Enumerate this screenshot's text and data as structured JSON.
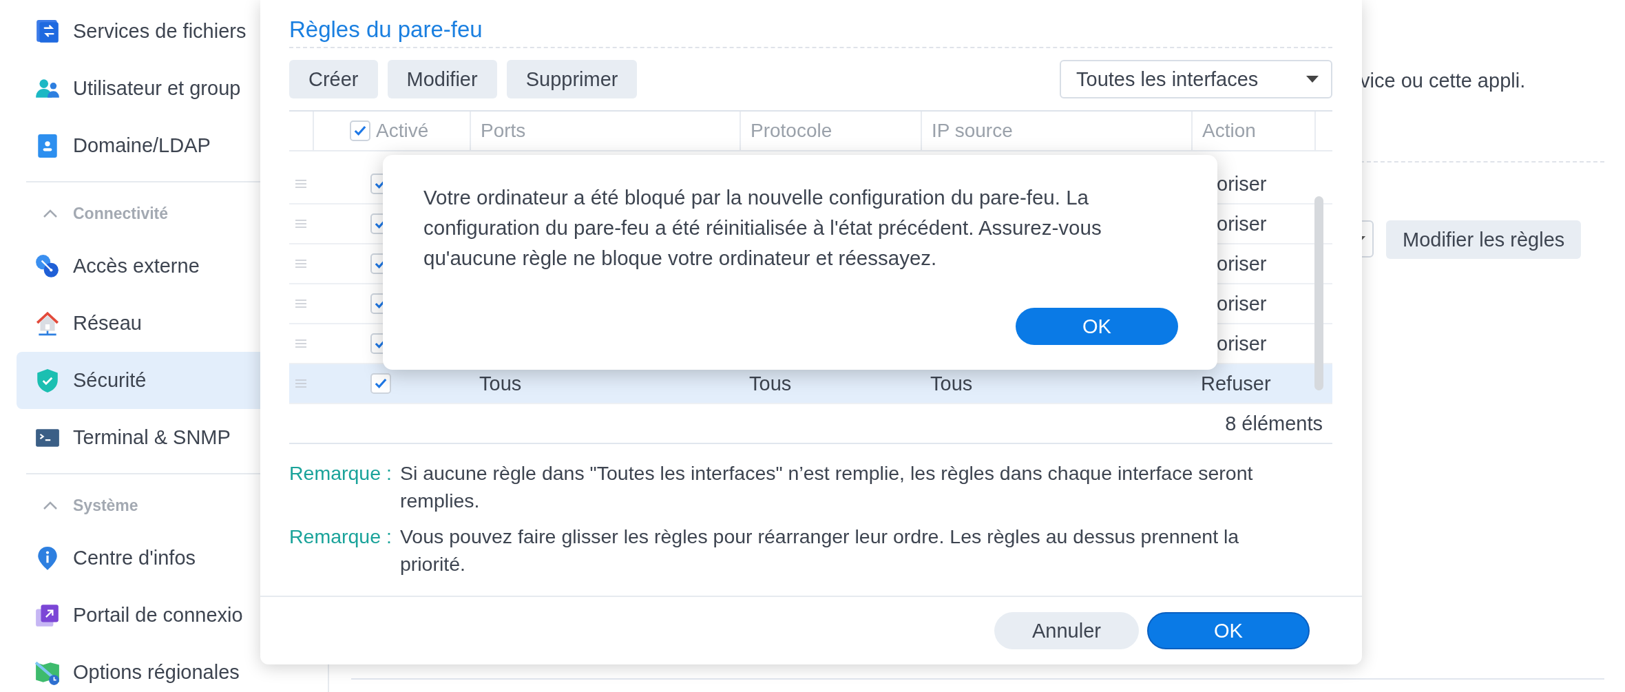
{
  "sidebar": {
    "items": [
      {
        "kind": "item",
        "label": "Services de fichiers",
        "selected": false
      },
      {
        "kind": "item",
        "label": "Utilisateur et group",
        "selected": false
      },
      {
        "kind": "item",
        "label": "Domaine/LDAP",
        "selected": false
      },
      {
        "kind": "header",
        "label": "Connectivité",
        "expanded": true
      },
      {
        "kind": "item",
        "label": "Accès externe",
        "selected": false
      },
      {
        "kind": "item",
        "label": "Réseau",
        "selected": false
      },
      {
        "kind": "item",
        "label": "Sécurité",
        "selected": true
      },
      {
        "kind": "item",
        "label": "Terminal & SNMP",
        "selected": false
      },
      {
        "kind": "header",
        "label": "Système",
        "expanded": true
      },
      {
        "kind": "item",
        "label": "Centre d'infos",
        "selected": false
      },
      {
        "kind": "item",
        "label": "Portail de connexio",
        "selected": false
      },
      {
        "kind": "item",
        "label": "Options régionales",
        "selected": false
      }
    ]
  },
  "background": {
    "description": "vice ou cette appli.",
    "button": "Modifier les règles"
  },
  "dialog": {
    "title": "Règles du pare-feu",
    "toolbar": {
      "buttons": [
        "Créer",
        "Modifier",
        "Supprimer"
      ],
      "interface_select": "Toutes les interfaces"
    },
    "table": {
      "select_all_checked": true,
      "columns": [
        "Activé",
        "Ports",
        "Protocole",
        "IP source",
        "Action"
      ],
      "rows": [
        {
          "checked": true,
          "action": "oriser",
          "selected": false
        },
        {
          "checked": true,
          "action": "oriser",
          "selected": false
        },
        {
          "checked": true,
          "action": "oriser",
          "selected": false
        },
        {
          "checked": true,
          "action": "oriser",
          "selected": false
        },
        {
          "checked": true,
          "action": "oriser",
          "selected": false
        },
        {
          "checked": true,
          "ports": "Tous",
          "protocol": "Tous",
          "source": "Tous",
          "action": "Refuser",
          "selected": true
        }
      ],
      "count": "8 éléments"
    },
    "notes": [
      {
        "label": "Remarque :",
        "text": "Si aucune règle dans \"Toutes les interfaces\" n’est remplie, les règles dans chaque interface seront remplies."
      },
      {
        "label": "Remarque :",
        "text": "Vous pouvez faire glisser les règles pour réarranger leur ordre. Les règles au dessus prennent la priorité."
      }
    ],
    "buttons": [
      {
        "label": "Annuler",
        "kind": "secondary"
      },
      {
        "label": "OK",
        "kind": "primary"
      }
    ]
  },
  "alert": {
    "message": "Votre ordinateur a été bloqué par la nouvelle configuration du pare-feu. La configuration du pare-feu a été réinitialisée à l'état précédent. Assurez-vous qu'aucune règle ne bloque votre ordinateur et réessayez.",
    "button": "OK"
  }
}
